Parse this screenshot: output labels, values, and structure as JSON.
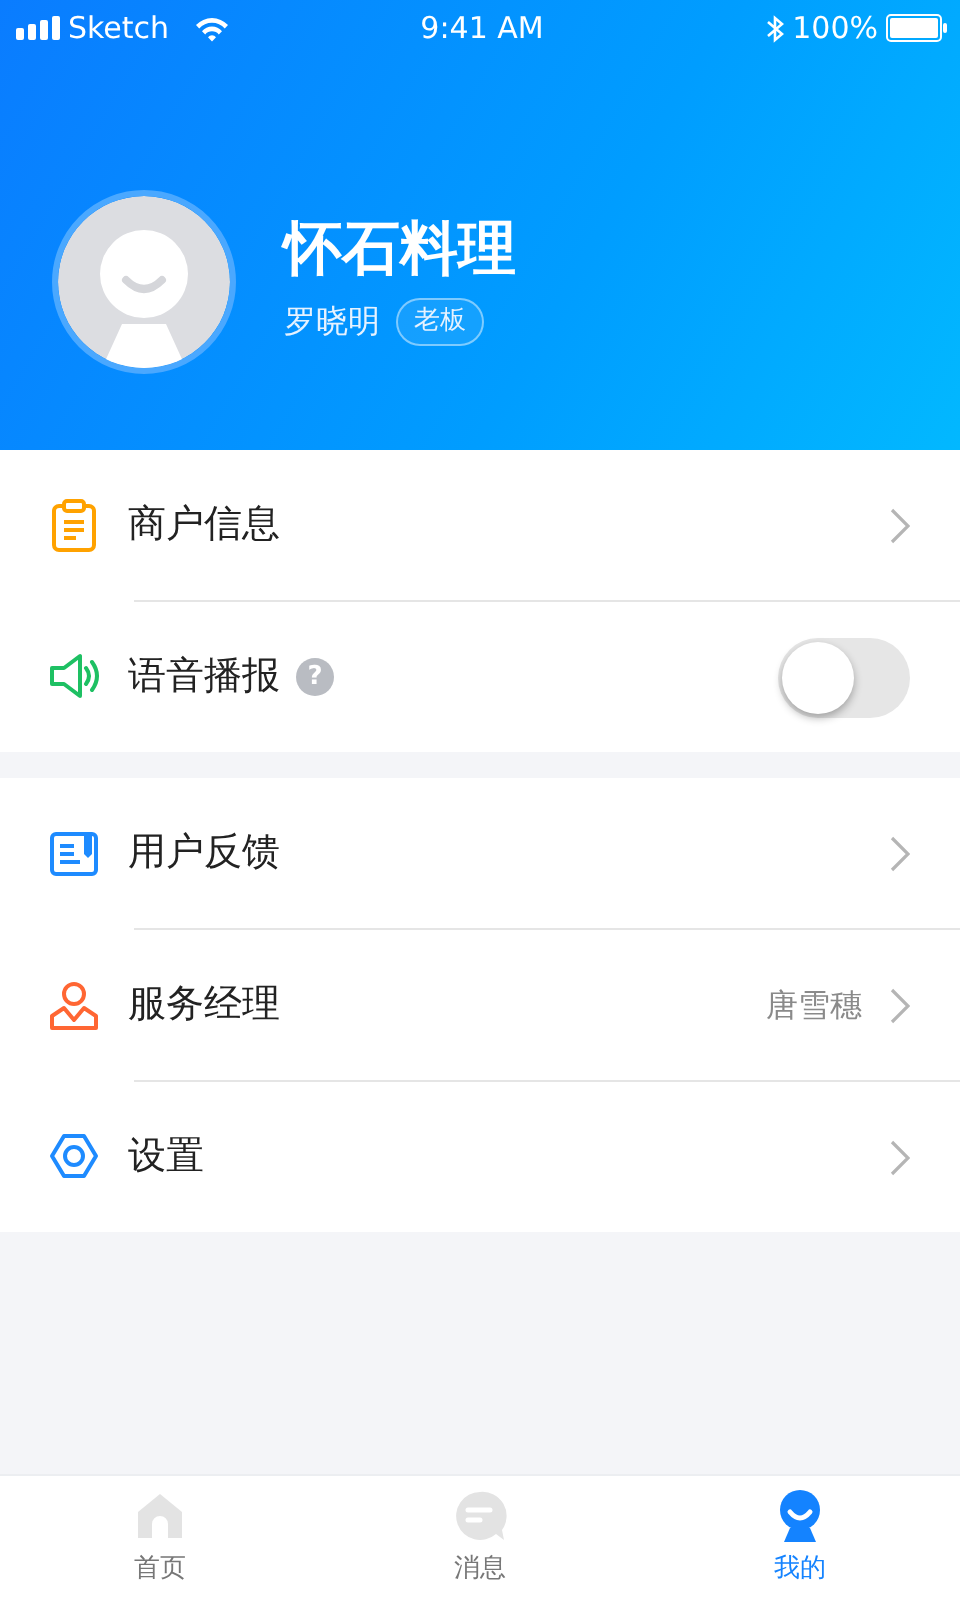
{
  "status_bar": {
    "carrier": "Sketch",
    "time": "9:41 AM",
    "battery": "100%"
  },
  "profile": {
    "shop_name": "怀石料理",
    "user_name": "罗晓明",
    "role": "老板"
  },
  "groups": [
    {
      "items": [
        {
          "kind": "link",
          "label": "商户信息"
        },
        {
          "kind": "toggle",
          "label": "语音播报",
          "help_mark": "?",
          "on": false
        }
      ]
    },
    {
      "items": [
        {
          "kind": "link",
          "label": "用户反馈"
        },
        {
          "kind": "link",
          "label": "服务经理",
          "value": "唐雪穗"
        },
        {
          "kind": "link",
          "label": "设置"
        }
      ]
    }
  ],
  "tabs": [
    {
      "label": "首页",
      "selected": false
    },
    {
      "label": "消息",
      "selected": false
    },
    {
      "label": "我的",
      "selected": true
    }
  ]
}
